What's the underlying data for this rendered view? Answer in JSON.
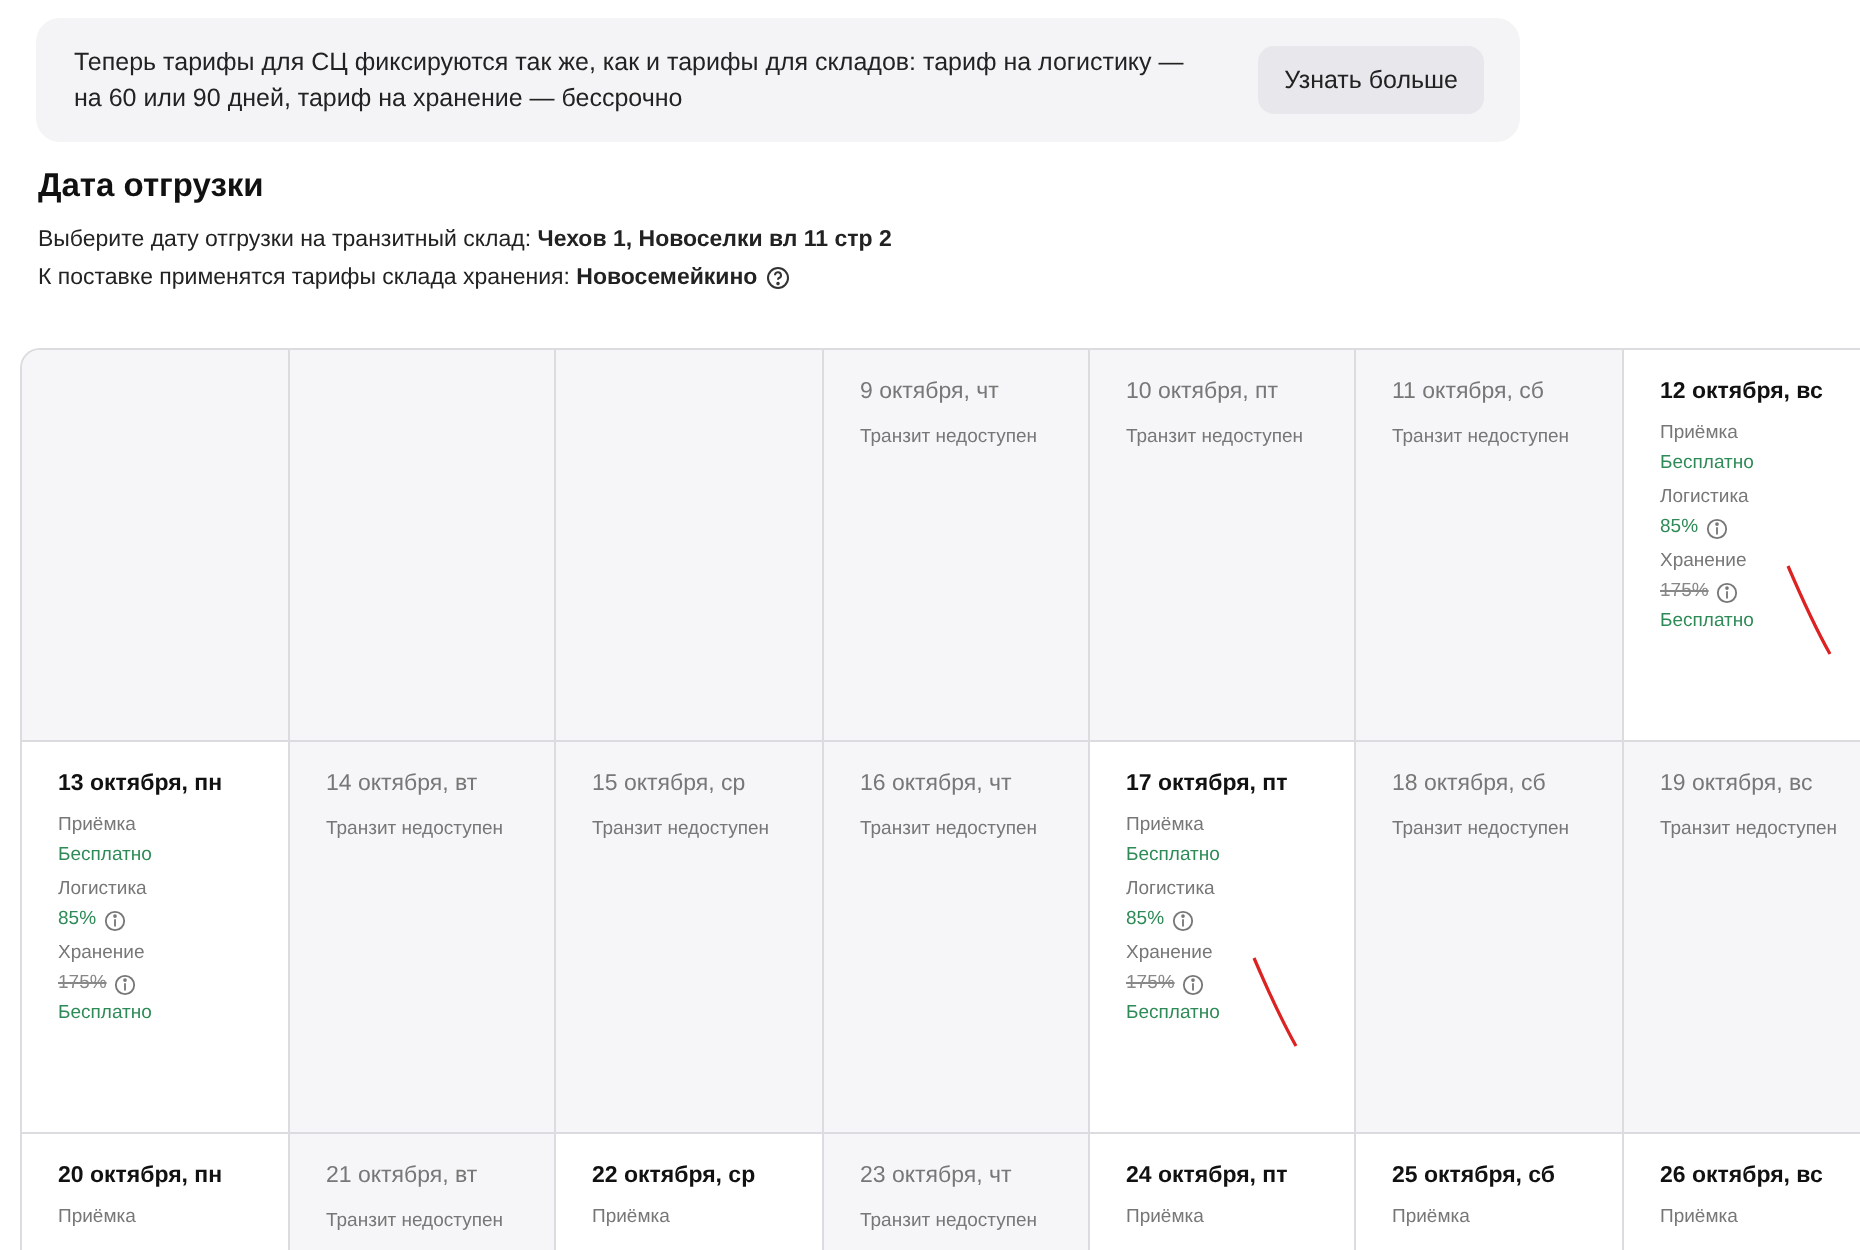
{
  "banner": {
    "text": "Теперь тарифы для СЦ фиксируются так же, как и тарифы для складов: тариф на логистику — на 60 или 90 дней, тариф на хранение — бессрочно",
    "button": "Узнать больше"
  },
  "heading": "Дата отгрузки",
  "lines": [
    {
      "text": "Выберите дату отгрузки на транзитный склад: **Чехов 1, Новоселки вл 11 стр 2**",
      "help": false
    },
    {
      "text": "К поставке применятся тарифы склада хранения: **Новосемейкино**",
      "help": true
    }
  ],
  "calendar": [
    [
      {
        "kind": "empty"
      },
      {
        "kind": "empty"
      },
      {
        "kind": "empty"
      },
      {
        "kind": "unavailable",
        "date": "9 октября, чт",
        "note": "Транзит недоступен"
      },
      {
        "kind": "unavailable",
        "date": "10 октября, пт",
        "note": "Транзит недоступен"
      },
      {
        "kind": "unavailable",
        "date": "11 октября, сб",
        "note": "Транзит недоступен"
      },
      {
        "kind": "available",
        "date": "12 октября, вс",
        "pen_mark": true,
        "items": [
          {
            "label": "Приёмка",
            "value": "Бесплатно",
            "info": false
          },
          {
            "label": "Логистика",
            "value": "85%",
            "info": true
          },
          {
            "label": "Хранение",
            "old_value": "175%",
            "value": "Бесплатно",
            "info": true
          }
        ]
      }
    ],
    [
      {
        "kind": "available",
        "date": "13 октября, пн",
        "pen_mark": false,
        "items": [
          {
            "label": "Приёмка",
            "value": "Бесплатно",
            "info": false
          },
          {
            "label": "Логистика",
            "value": "85%",
            "info": true
          },
          {
            "label": "Хранение",
            "old_value": "175%",
            "value": "Бесплатно",
            "info": true
          }
        ]
      },
      {
        "kind": "unavailable",
        "date": "14 октября, вт",
        "note": "Транзит недоступен"
      },
      {
        "kind": "unavailable",
        "date": "15 октября, ср",
        "note": "Транзит недоступен"
      },
      {
        "kind": "unavailable",
        "date": "16 октября, чт",
        "note": "Транзит недоступен"
      },
      {
        "kind": "available",
        "date": "17 октября, пт",
        "pen_mark": true,
        "items": [
          {
            "label": "Приёмка",
            "value": "Бесплатно",
            "info": false
          },
          {
            "label": "Логистика",
            "value": "85%",
            "info": true
          },
          {
            "label": "Хранение",
            "old_value": "175%",
            "value": "Бесплатно",
            "info": true
          }
        ]
      },
      {
        "kind": "unavailable",
        "date": "18 октября, сб",
        "note": "Транзит недоступен"
      },
      {
        "kind": "unavailable",
        "date": "19 октября, вс",
        "note": "Транзит недоступен"
      }
    ],
    [
      {
        "kind": "available",
        "date": "20 октября, пн",
        "pen_mark": false,
        "items": [
          {
            "label": "Приёмка"
          }
        ]
      },
      {
        "kind": "unavailable",
        "date": "21 октября, вт",
        "note": "Транзит недоступен"
      },
      {
        "kind": "available",
        "date": "22 октября, ср",
        "pen_mark": false,
        "items": [
          {
            "label": "Приёмка"
          }
        ]
      },
      {
        "kind": "unavailable",
        "date": "23 октября, чт",
        "note": "Транзит недоступен"
      },
      {
        "kind": "available",
        "date": "24 октября, пт",
        "pen_mark": false,
        "items": [
          {
            "label": "Приёмка"
          }
        ]
      },
      {
        "kind": "available",
        "date": "25 октября, сб",
        "pen_mark": false,
        "items": [
          {
            "label": "Приёмка"
          }
        ]
      },
      {
        "kind": "available",
        "date": "26 октября, вс",
        "pen_mark": false,
        "items": [
          {
            "label": "Приёмка"
          }
        ]
      }
    ]
  ]
}
